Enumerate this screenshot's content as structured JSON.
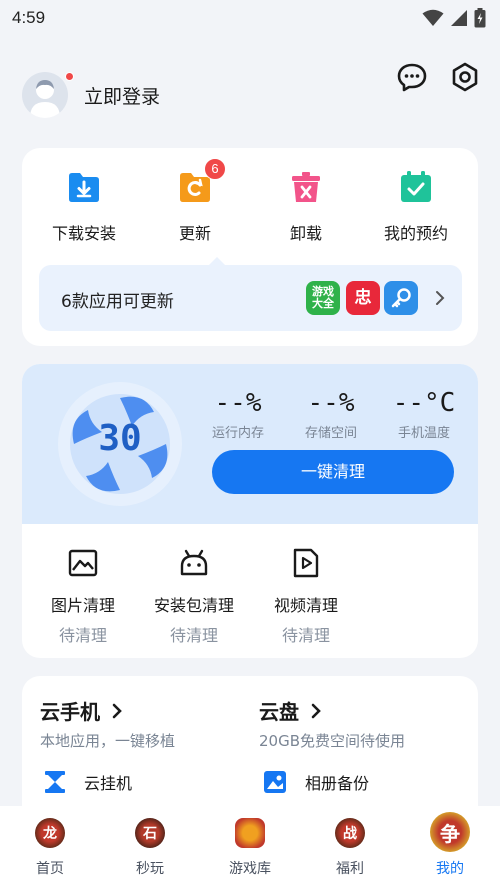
{
  "status_bar": {
    "time": "4:59"
  },
  "header": {
    "login_text": "立即登录"
  },
  "manager": {
    "items": [
      {
        "label": "下载安装",
        "icon": "download-folder-icon",
        "color": "#1a8cf0"
      },
      {
        "label": "更新",
        "icon": "update-icon",
        "color": "#f59a1a",
        "badge": "6"
      },
      {
        "label": "卸载",
        "icon": "trash-icon",
        "color": "#f2548a"
      },
      {
        "label": "我的预约",
        "icon": "calendar-check-icon",
        "color": "#1fc39a"
      }
    ],
    "update_text": "6款应用可更新",
    "apps": [
      {
        "label": "游戏大全",
        "color": "#2fb24a"
      },
      {
        "label": "忠",
        "color": "#e8283a"
      },
      {
        "label": "",
        "color": "#2e8fe8"
      }
    ]
  },
  "cleaner": {
    "score": "30",
    "stats": [
      {
        "value": "--%",
        "label": "运行内存"
      },
      {
        "value": "--%",
        "label": "存储空间"
      },
      {
        "value": "--°C",
        "label": "手机温度"
      }
    ],
    "button_label": "一键清理",
    "items": [
      {
        "label": "图片清理",
        "status": "待清理",
        "icon": "image-icon"
      },
      {
        "label": "安装包清理",
        "status": "待清理",
        "icon": "android-icon"
      },
      {
        "label": "视频清理",
        "status": "待清理",
        "icon": "video-icon"
      }
    ]
  },
  "cloud": {
    "phone_title": "云手机",
    "phone_sub": "本地应用，一键移植",
    "disk_title": "云盘",
    "disk_sub": "20GB免费空间待使用",
    "hang_label": "云挂机",
    "album_label": "相册备份"
  },
  "nav": {
    "items": [
      {
        "label": "首页",
        "glyph": "龙"
      },
      {
        "label": "秒玩",
        "glyph": "石"
      },
      {
        "label": "游戏库",
        "glyph": ""
      },
      {
        "label": "福利",
        "glyph": "战"
      },
      {
        "label": "我的",
        "glyph": "争"
      }
    ]
  },
  "colors": {
    "accent": "#1677f2",
    "badge": "#f04848"
  }
}
